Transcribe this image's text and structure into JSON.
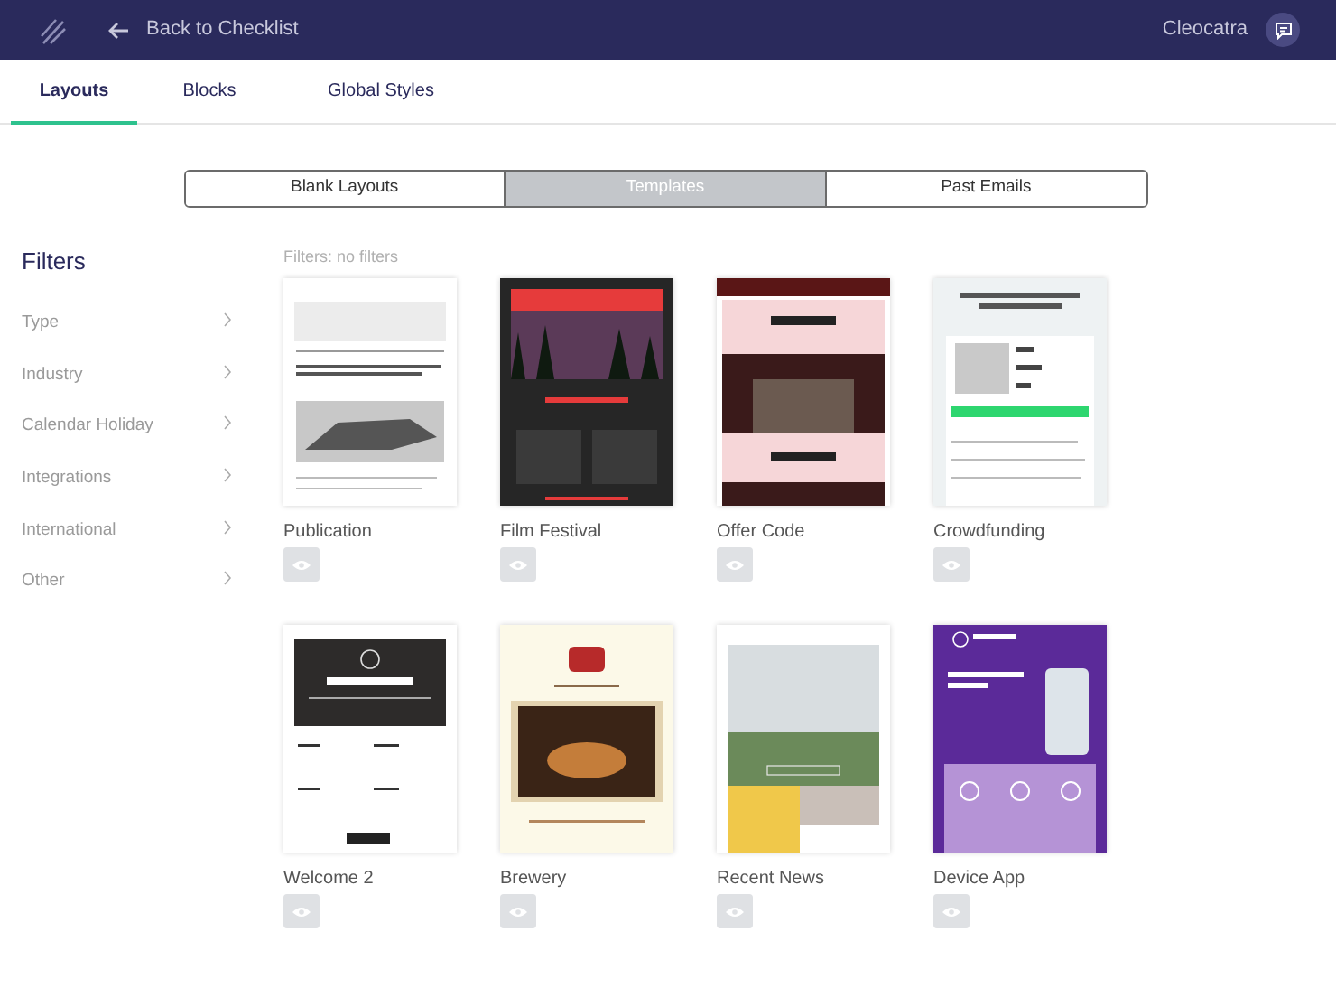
{
  "header": {
    "back_link": "Back to Checklist",
    "user": "Cleocatra"
  },
  "tabs": [
    {
      "label": "Layouts",
      "selected": true
    },
    {
      "label": "Blocks",
      "selected": false
    },
    {
      "label": "Global Styles",
      "selected": false
    }
  ],
  "segments": [
    {
      "label": "Blank Layouts",
      "selected": false
    },
    {
      "label": "Templates",
      "selected": true
    },
    {
      "label": "Past Emails",
      "selected": false
    }
  ],
  "filters": {
    "title": "Filters",
    "items": [
      "Type",
      "Industry",
      "Calendar Holiday",
      "Integrations",
      "International",
      "Other"
    ]
  },
  "filter_status": "Filters: no filters",
  "templates": [
    {
      "name": "Publication"
    },
    {
      "name": "Film Festival"
    },
    {
      "name": "Offer Code"
    },
    {
      "name": "Crowdfunding"
    },
    {
      "name": "Welcome 2"
    },
    {
      "name": "Brewery"
    },
    {
      "name": "Recent News"
    },
    {
      "name": "Device App"
    }
  ]
}
